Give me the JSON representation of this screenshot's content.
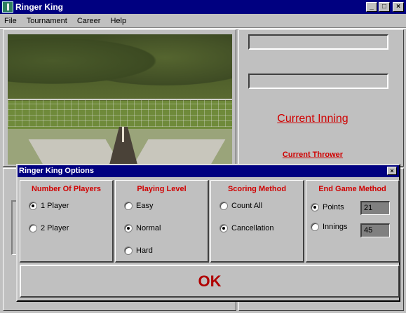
{
  "window": {
    "title": "Ringer King",
    "minimize": "_",
    "maximize": "□",
    "close": "×"
  },
  "menu": {
    "items": [
      {
        "label": "File"
      },
      {
        "label": "Tournament"
      },
      {
        "label": "Career"
      },
      {
        "label": "Help"
      }
    ]
  },
  "right_panel": {
    "current_inning": "Current Inning",
    "current_thrower": "Current Thrower"
  },
  "dialog": {
    "title": "Ringer King Options",
    "close": "×",
    "players": {
      "title": "Number Of Players",
      "options": [
        "1 Player",
        "2 Player"
      ],
      "selected": "1 Player"
    },
    "level": {
      "title": "Playing Level",
      "options": [
        "Easy",
        "Normal",
        "Hard"
      ],
      "selected": "Normal"
    },
    "scoring": {
      "title": "Scoring Method",
      "options": [
        "Count All",
        "Cancellation"
      ],
      "selected": "Cancellation"
    },
    "endgame": {
      "title": "End Game Method",
      "options": [
        "Points",
        "Innings"
      ],
      "selected": "Points",
      "points_value": "21",
      "innings_value": "45"
    },
    "ok_label": "OK"
  },
  "colors": {
    "title_bar": "#000080",
    "accent_red": "#d00000",
    "face": "#c0c0c0"
  }
}
